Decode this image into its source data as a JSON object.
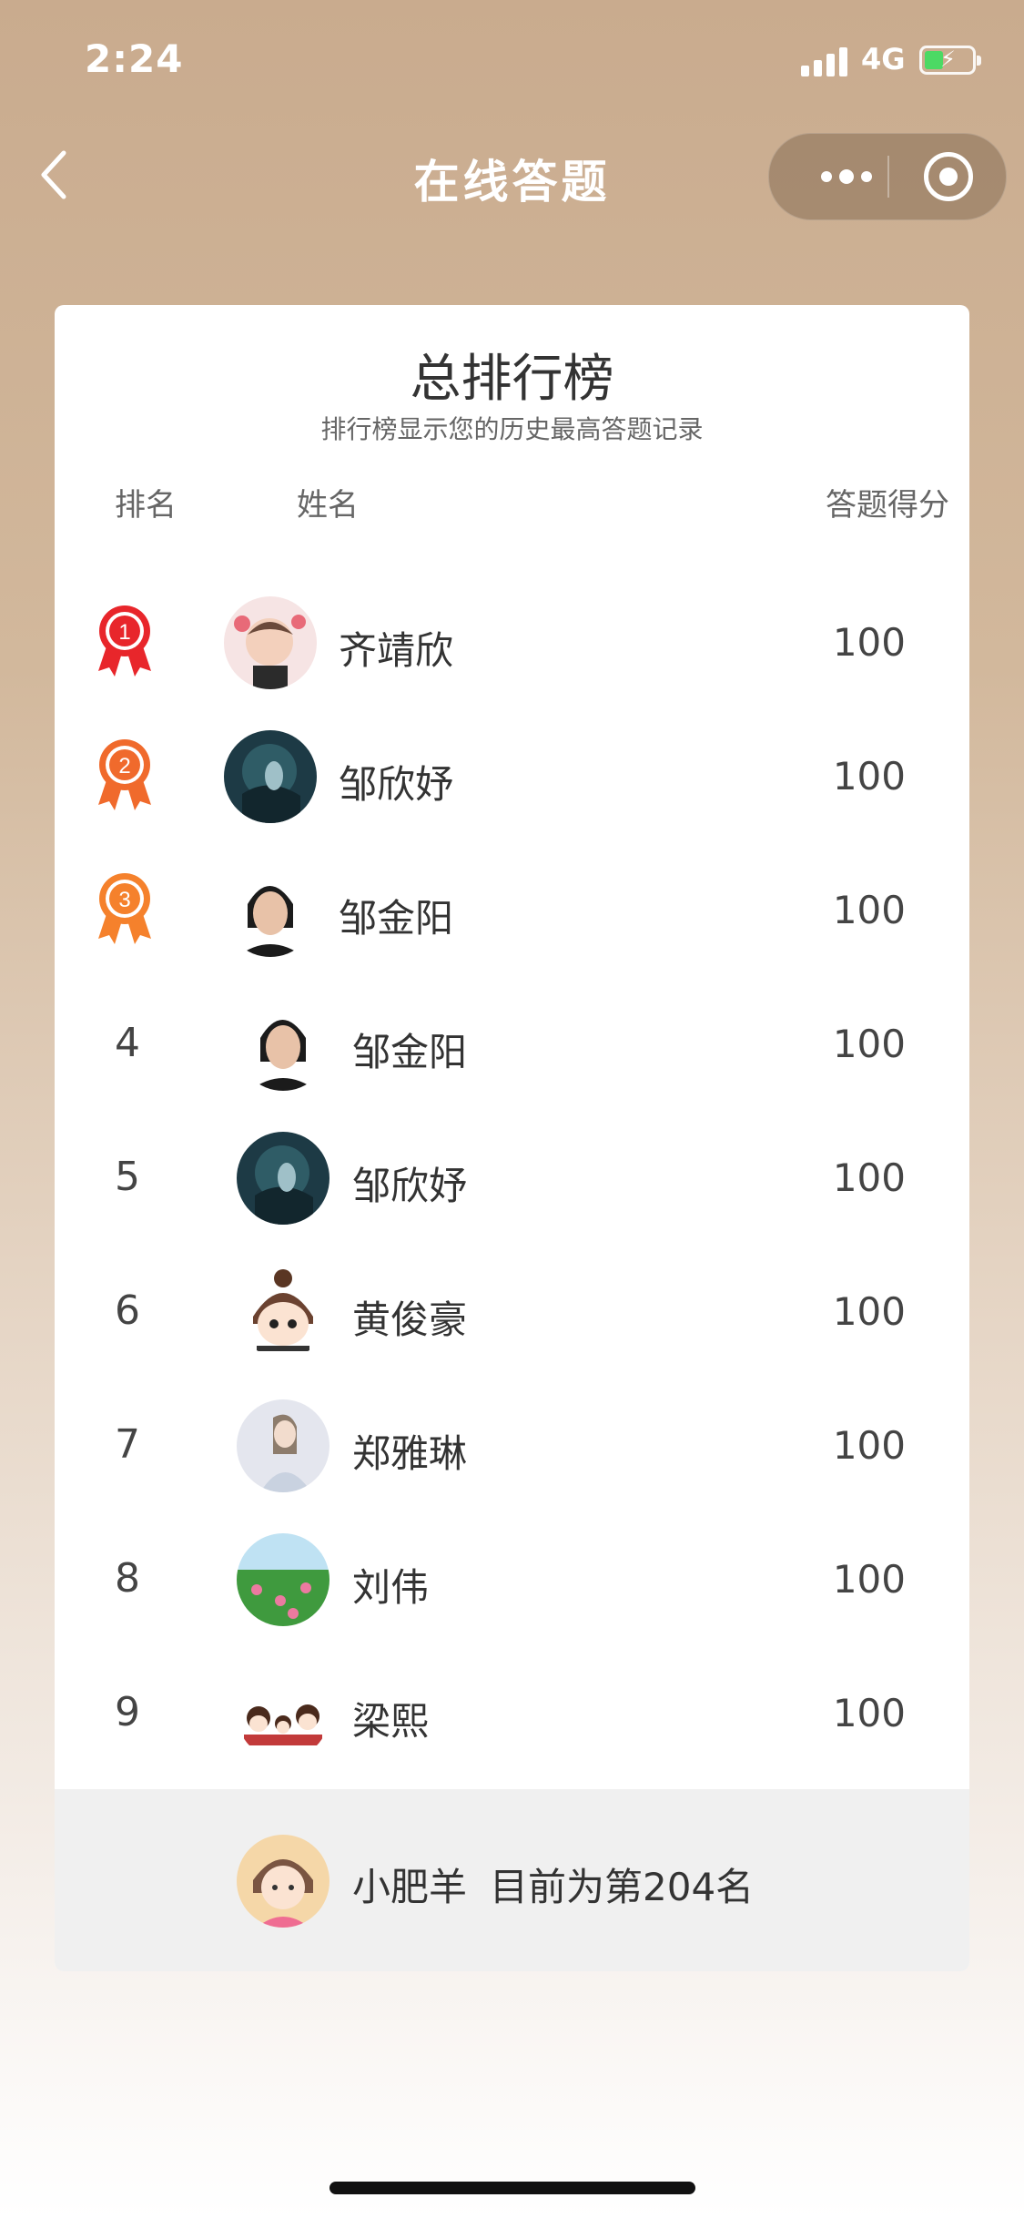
{
  "status_bar": {
    "time": "2:24",
    "network": "4G"
  },
  "nav": {
    "title": "在线答题"
  },
  "leaderboard": {
    "title": "总排行榜",
    "subtitle": "排行榜显示您的历史最高答题记录",
    "columns": {
      "rank": "排名",
      "name": "姓名",
      "score": "答题得分"
    },
    "rows": [
      {
        "rank": "1",
        "name": "齐靖欣",
        "score": "100"
      },
      {
        "rank": "2",
        "name": "邹欣妤",
        "score": "100"
      },
      {
        "rank": "3",
        "name": "邹金阳",
        "score": "100"
      },
      {
        "rank": "4",
        "name": "邹金阳",
        "score": "100"
      },
      {
        "rank": "5",
        "name": "邹欣妤",
        "score": "100"
      },
      {
        "rank": "6",
        "name": "黄俊豪",
        "score": "100"
      },
      {
        "rank": "7",
        "name": "郑雅琳",
        "score": "100"
      },
      {
        "rank": "8",
        "name": "刘伟",
        "score": "100"
      },
      {
        "rank": "9",
        "name": "梁熙",
        "score": "100"
      }
    ],
    "me": {
      "name": "小肥羊",
      "rank_text": "目前为第204名"
    }
  },
  "colors": {
    "medal_gold": "#e8262b",
    "medal_silver": "#f06a2c",
    "medal_bronze": "#f5812c",
    "card_bg": "#ffffff",
    "me_bar_bg": "#f0f0f0"
  }
}
